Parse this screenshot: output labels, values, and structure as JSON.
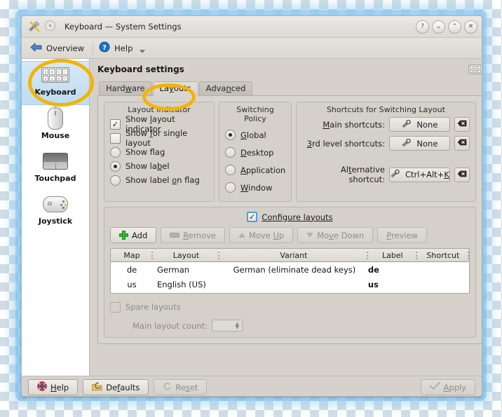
{
  "window": {
    "title": "Keyboard — System Settings",
    "icon": "tools-icon",
    "controls": [
      {
        "name": "help-button",
        "glyph": "?"
      },
      {
        "name": "minimize-button",
        "glyph": "⌄"
      },
      {
        "name": "maximize-button",
        "glyph": "⌃"
      },
      {
        "name": "close-button",
        "glyph": "✕"
      }
    ]
  },
  "toolbar": {
    "overview_label": "Overview",
    "overview_icon": "back-arrow-icon",
    "help_label": "Help",
    "help_icon": "help-circle-icon"
  },
  "sidebar": {
    "items": [
      {
        "label": "Keyboard",
        "icon": "keyboard-icon",
        "selected": true
      },
      {
        "label": "Mouse",
        "icon": "mouse-icon",
        "selected": false
      },
      {
        "label": "Touchpad",
        "icon": "touchpad-icon",
        "selected": false
      },
      {
        "label": "Joystick",
        "icon": "joystick-icon",
        "selected": false
      }
    ]
  },
  "main": {
    "page_title": "Keyboard settings",
    "header_icon": "keyboard-small-icon",
    "tabs": [
      {
        "label": "Hardware",
        "mnemonic": "w",
        "active": false
      },
      {
        "label": "Layouts",
        "mnemonic": "y",
        "active": true
      },
      {
        "label": "Advanced",
        "mnemonic": "n",
        "active": false
      }
    ]
  },
  "layout_indicator": {
    "title": "Layout Indicator",
    "options": [
      {
        "label": "Show layout indicator",
        "mnemonic": "l",
        "type": "checkbox",
        "checked": true
      },
      {
        "label": "Show for single layout",
        "mnemonic": "f",
        "type": "checkbox",
        "checked": false
      },
      {
        "label": "Show flag",
        "mnemonic": "",
        "type": "radio",
        "checked": false
      },
      {
        "label": "Show label",
        "mnemonic": "b",
        "type": "radio",
        "checked": true
      },
      {
        "label": "Show label on flag",
        "mnemonic": "o",
        "type": "radio",
        "checked": false
      }
    ]
  },
  "switching_policy": {
    "title": "Switching Policy",
    "options": [
      {
        "label": "Global",
        "mnemonic": "G",
        "checked": true
      },
      {
        "label": "Desktop",
        "mnemonic": "D",
        "checked": false
      },
      {
        "label": "Application",
        "mnemonic": "A",
        "checked": false
      },
      {
        "label": "Window",
        "mnemonic": "W",
        "checked": false
      }
    ]
  },
  "shortcuts": {
    "title": "Shortcuts for Switching Layout",
    "rows": [
      {
        "label": "Main shortcuts:",
        "mnemonic": "M",
        "value": "None",
        "icon": "wrench-icon",
        "clear_icon": "backspace-icon"
      },
      {
        "label": "3rd level shortcuts:",
        "mnemonic": "3",
        "value": "None",
        "icon": "wrench-icon",
        "clear_icon": "backspace-icon"
      },
      {
        "label": "Alternative shortcut:",
        "mnemonic": "A",
        "value": "Ctrl+Alt+K",
        "icon": "wrench-icon",
        "clear_icon": "backspace-icon"
      }
    ]
  },
  "configure": {
    "checkbox_label": "Configure layouts",
    "checkbox_mnemonic": "C",
    "checked": true,
    "buttons": [
      {
        "label": "Add",
        "icon": "plus-icon",
        "enabled": true
      },
      {
        "label": "Remove",
        "mnemonic": "R",
        "icon": "minus-icon",
        "enabled": false
      },
      {
        "label": "Move Up",
        "mnemonic": "U",
        "icon": "triangle-up-icon",
        "enabled": false
      },
      {
        "label": "Move Down",
        "mnemonic": "v",
        "icon": "triangle-down-icon",
        "enabled": false
      },
      {
        "label": "Preview",
        "mnemonic": "P",
        "icon": "",
        "enabled": false
      }
    ]
  },
  "layout_table": {
    "columns": [
      "Map",
      "Layout",
      "Variant",
      "Label",
      "Shortcut"
    ],
    "rows": [
      {
        "map": "de",
        "layout": "German",
        "variant": "German (eliminate dead keys)",
        "label": "de",
        "shortcut": ""
      },
      {
        "map": "us",
        "layout": "English (US)",
        "variant": "",
        "label": "us",
        "shortcut": ""
      }
    ]
  },
  "spare": {
    "checkbox_label": "Spare layouts",
    "checked": false,
    "count_label": "Main layout count:",
    "count_value": ""
  },
  "bottom": {
    "help": {
      "label": "Help",
      "mnemonic": "H",
      "icon": "lifering-icon",
      "enabled": true
    },
    "defaults": {
      "label": "Defaults",
      "mnemonic": "f",
      "icon": "undo-folder-icon",
      "enabled": true
    },
    "reset": {
      "label": "Reset",
      "mnemonic": "s",
      "icon": "reset-icon",
      "enabled": false
    },
    "apply": {
      "label": "Apply",
      "mnemonic": "A",
      "icon": "check-icon",
      "enabled": false
    }
  },
  "annotations": {
    "accent_color": "#f5b301",
    "highlighted": [
      "sidebar-item-keyboard",
      "tab-layouts"
    ]
  }
}
